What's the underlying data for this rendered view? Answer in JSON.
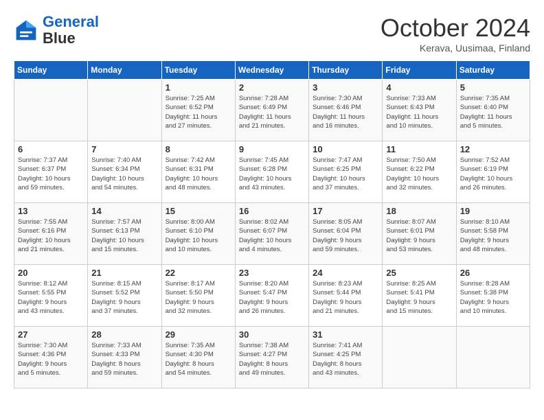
{
  "header": {
    "logo_line1": "General",
    "logo_line2": "Blue",
    "month": "October 2024",
    "location": "Kerava, Uusimaa, Finland"
  },
  "weekdays": [
    "Sunday",
    "Monday",
    "Tuesday",
    "Wednesday",
    "Thursday",
    "Friday",
    "Saturday"
  ],
  "weeks": [
    [
      {
        "day": "",
        "info": ""
      },
      {
        "day": "",
        "info": ""
      },
      {
        "day": "1",
        "info": "Sunrise: 7:25 AM\nSunset: 6:52 PM\nDaylight: 11 hours\nand 27 minutes."
      },
      {
        "day": "2",
        "info": "Sunrise: 7:28 AM\nSunset: 6:49 PM\nDaylight: 11 hours\nand 21 minutes."
      },
      {
        "day": "3",
        "info": "Sunrise: 7:30 AM\nSunset: 6:46 PM\nDaylight: 11 hours\nand 16 minutes."
      },
      {
        "day": "4",
        "info": "Sunrise: 7:33 AM\nSunset: 6:43 PM\nDaylight: 11 hours\nand 10 minutes."
      },
      {
        "day": "5",
        "info": "Sunrise: 7:35 AM\nSunset: 6:40 PM\nDaylight: 11 hours\nand 5 minutes."
      }
    ],
    [
      {
        "day": "6",
        "info": "Sunrise: 7:37 AM\nSunset: 6:37 PM\nDaylight: 10 hours\nand 59 minutes."
      },
      {
        "day": "7",
        "info": "Sunrise: 7:40 AM\nSunset: 6:34 PM\nDaylight: 10 hours\nand 54 minutes."
      },
      {
        "day": "8",
        "info": "Sunrise: 7:42 AM\nSunset: 6:31 PM\nDaylight: 10 hours\nand 48 minutes."
      },
      {
        "day": "9",
        "info": "Sunrise: 7:45 AM\nSunset: 6:28 PM\nDaylight: 10 hours\nand 43 minutes."
      },
      {
        "day": "10",
        "info": "Sunrise: 7:47 AM\nSunset: 6:25 PM\nDaylight: 10 hours\nand 37 minutes."
      },
      {
        "day": "11",
        "info": "Sunrise: 7:50 AM\nSunset: 6:22 PM\nDaylight: 10 hours\nand 32 minutes."
      },
      {
        "day": "12",
        "info": "Sunrise: 7:52 AM\nSunset: 6:19 PM\nDaylight: 10 hours\nand 26 minutes."
      }
    ],
    [
      {
        "day": "13",
        "info": "Sunrise: 7:55 AM\nSunset: 6:16 PM\nDaylight: 10 hours\nand 21 minutes."
      },
      {
        "day": "14",
        "info": "Sunrise: 7:57 AM\nSunset: 6:13 PM\nDaylight: 10 hours\nand 15 minutes."
      },
      {
        "day": "15",
        "info": "Sunrise: 8:00 AM\nSunset: 6:10 PM\nDaylight: 10 hours\nand 10 minutes."
      },
      {
        "day": "16",
        "info": "Sunrise: 8:02 AM\nSunset: 6:07 PM\nDaylight: 10 hours\nand 4 minutes."
      },
      {
        "day": "17",
        "info": "Sunrise: 8:05 AM\nSunset: 6:04 PM\nDaylight: 9 hours\nand 59 minutes."
      },
      {
        "day": "18",
        "info": "Sunrise: 8:07 AM\nSunset: 6:01 PM\nDaylight: 9 hours\nand 53 minutes."
      },
      {
        "day": "19",
        "info": "Sunrise: 8:10 AM\nSunset: 5:58 PM\nDaylight: 9 hours\nand 48 minutes."
      }
    ],
    [
      {
        "day": "20",
        "info": "Sunrise: 8:12 AM\nSunset: 5:55 PM\nDaylight: 9 hours\nand 43 minutes."
      },
      {
        "day": "21",
        "info": "Sunrise: 8:15 AM\nSunset: 5:52 PM\nDaylight: 9 hours\nand 37 minutes."
      },
      {
        "day": "22",
        "info": "Sunrise: 8:17 AM\nSunset: 5:50 PM\nDaylight: 9 hours\nand 32 minutes."
      },
      {
        "day": "23",
        "info": "Sunrise: 8:20 AM\nSunset: 5:47 PM\nDaylight: 9 hours\nand 26 minutes."
      },
      {
        "day": "24",
        "info": "Sunrise: 8:23 AM\nSunset: 5:44 PM\nDaylight: 9 hours\nand 21 minutes."
      },
      {
        "day": "25",
        "info": "Sunrise: 8:25 AM\nSunset: 5:41 PM\nDaylight: 9 hours\nand 15 minutes."
      },
      {
        "day": "26",
        "info": "Sunrise: 8:28 AM\nSunset: 5:38 PM\nDaylight: 9 hours\nand 10 minutes."
      }
    ],
    [
      {
        "day": "27",
        "info": "Sunrise: 7:30 AM\nSunset: 4:36 PM\nDaylight: 9 hours\nand 5 minutes."
      },
      {
        "day": "28",
        "info": "Sunrise: 7:33 AM\nSunset: 4:33 PM\nDaylight: 8 hours\nand 59 minutes."
      },
      {
        "day": "29",
        "info": "Sunrise: 7:35 AM\nSunset: 4:30 PM\nDaylight: 8 hours\nand 54 minutes."
      },
      {
        "day": "30",
        "info": "Sunrise: 7:38 AM\nSunset: 4:27 PM\nDaylight: 8 hours\nand 49 minutes."
      },
      {
        "day": "31",
        "info": "Sunrise: 7:41 AM\nSunset: 4:25 PM\nDaylight: 8 hours\nand 43 minutes."
      },
      {
        "day": "",
        "info": ""
      },
      {
        "day": "",
        "info": ""
      }
    ]
  ]
}
